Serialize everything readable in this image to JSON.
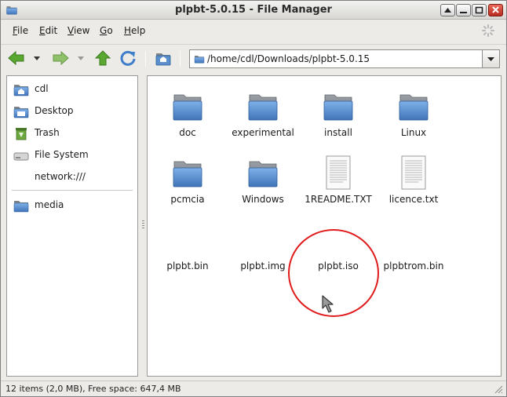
{
  "window": {
    "title": "plpbt-5.0.15 - File Manager"
  },
  "menubar": {
    "items": [
      {
        "ul": "F",
        "rest": "ile"
      },
      {
        "ul": "E",
        "rest": "dit"
      },
      {
        "ul": "V",
        "rest": "iew"
      },
      {
        "ul": "G",
        "rest": "o"
      },
      {
        "ul": "H",
        "rest": "elp"
      }
    ]
  },
  "toolbar": {
    "location_path": "/home/cdl/Downloads/plpbt-5.0.15"
  },
  "sidepane": {
    "items": [
      {
        "label": "cdl",
        "icon": "home-folder-icon"
      },
      {
        "label": "Desktop",
        "icon": "desktop-icon"
      },
      {
        "label": "Trash",
        "icon": "trash-icon"
      },
      {
        "label": "File System",
        "icon": "drive-icon"
      },
      {
        "label": "network:///",
        "icon": ""
      },
      {
        "label": "media",
        "icon": "folder-icon"
      }
    ]
  },
  "files": [
    {
      "name": "doc",
      "type": "folder"
    },
    {
      "name": "experimental",
      "type": "folder"
    },
    {
      "name": "install",
      "type": "folder"
    },
    {
      "name": "Linux",
      "type": "folder"
    },
    {
      "name": "pcmcia",
      "type": "folder"
    },
    {
      "name": "Windows",
      "type": "folder"
    },
    {
      "name": "1README.TXT",
      "type": "text"
    },
    {
      "name": "licence.txt",
      "type": "text"
    },
    {
      "name": "plpbt.bin",
      "type": "none"
    },
    {
      "name": "plpbt.img",
      "type": "none"
    },
    {
      "name": "plpbt.iso",
      "type": "none"
    },
    {
      "name": "plpbtrom.bin",
      "type": "none"
    }
  ],
  "statusbar": {
    "text": "12 items (2,0 MB), Free space: 647,4 MB"
  },
  "colors": {
    "folder": "#5a8fce",
    "highlight": "#e01b1b",
    "arrow_green": "#5aa832"
  }
}
